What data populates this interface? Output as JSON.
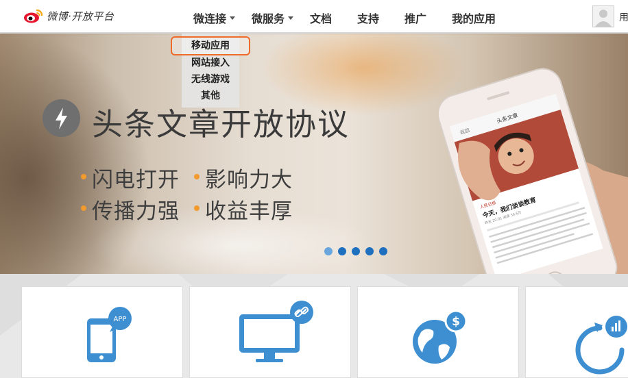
{
  "header": {
    "logo_text": "微博·开放平台",
    "nav": [
      {
        "label": "微连接",
        "has_dropdown": true
      },
      {
        "label": "微服务",
        "has_dropdown": true
      },
      {
        "label": "文档",
        "has_dropdown": false
      },
      {
        "label": "支持",
        "has_dropdown": false
      },
      {
        "label": "推广",
        "has_dropdown": false
      },
      {
        "label": "我的应用",
        "has_dropdown": false
      }
    ],
    "user_text": "用"
  },
  "dropdown": {
    "items": [
      "移动应用",
      "网站接入",
      "无线游戏",
      "其他"
    ],
    "selected": "移动应用"
  },
  "banner": {
    "headline": "头条文章开放协议",
    "features": [
      "闪电打开",
      "影响力大",
      "传播力强",
      "收益丰厚"
    ],
    "slide_count": 5,
    "active_slide": 1,
    "phone_screen": {
      "nav_back": "返回",
      "nav_title": "头条文章",
      "source": "人民日报",
      "article_title": "今天，我们谈谈教育",
      "meta": "昨天 20:01  阅读 36.6万"
    }
  },
  "cards": {
    "icons": [
      "mobile-app-icon",
      "website-link-icon",
      "global-monetize-icon",
      "growth-stats-icon"
    ],
    "app_badge": "APP"
  },
  "colors": {
    "accent_orange": "#ef6b2a",
    "bullet_orange": "#f29a2e",
    "icon_blue": "#3d8fd1",
    "dot_blue": "#1f6fbf"
  }
}
